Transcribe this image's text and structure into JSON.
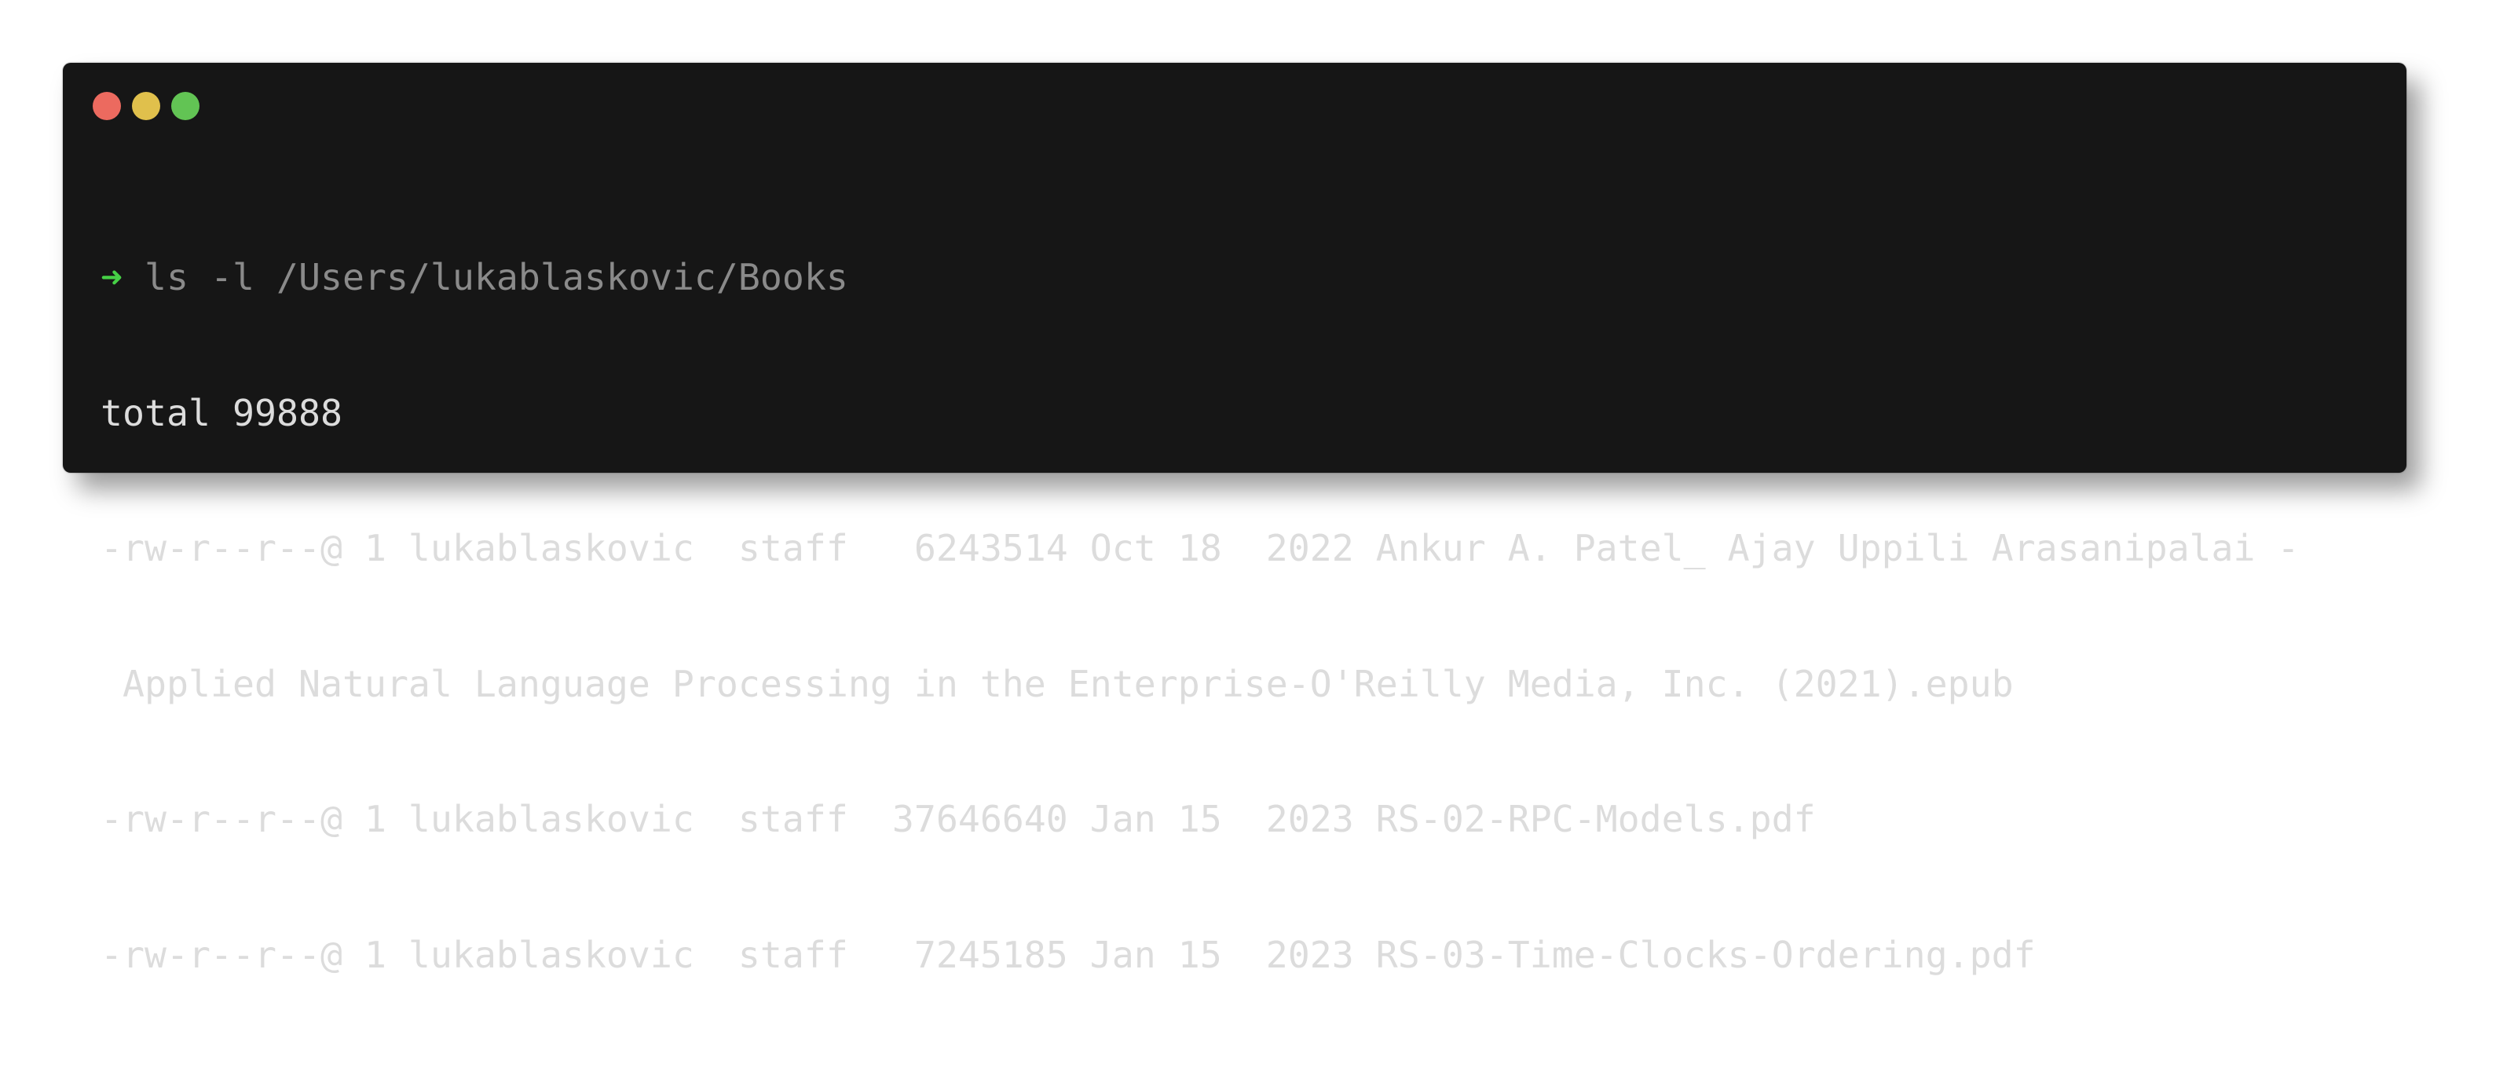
{
  "window": {
    "controls": [
      {
        "name": "close",
        "color": "#ec6a5f"
      },
      {
        "name": "minimize",
        "color": "#e0c04c"
      },
      {
        "name": "zoom",
        "color": "#62c454"
      }
    ]
  },
  "terminal": {
    "prompt_symbol": "➜",
    "command": " ls -l /Users/lukablaskovic/Books",
    "output": [
      "total 99888",
      "-rw-r--r--@ 1 lukablaskovic  staff   6243514 Oct 18  2022 Ankur A. Patel_ Ajay Uppili Arasanipalai -",
      " Applied Natural Language Processing in the Enterprise-O'Reilly Media, Inc. (2021).epub",
      "-rw-r--r--@ 1 lukablaskovic  staff  37646640 Jan 15  2023 RS-02-RPC-Models.pdf",
      "-rw-r--r--@ 1 lukablaskovic  staff   7245185 Jan 15  2023 RS-03-Time-Clocks-Ordering.pdf"
    ]
  }
}
